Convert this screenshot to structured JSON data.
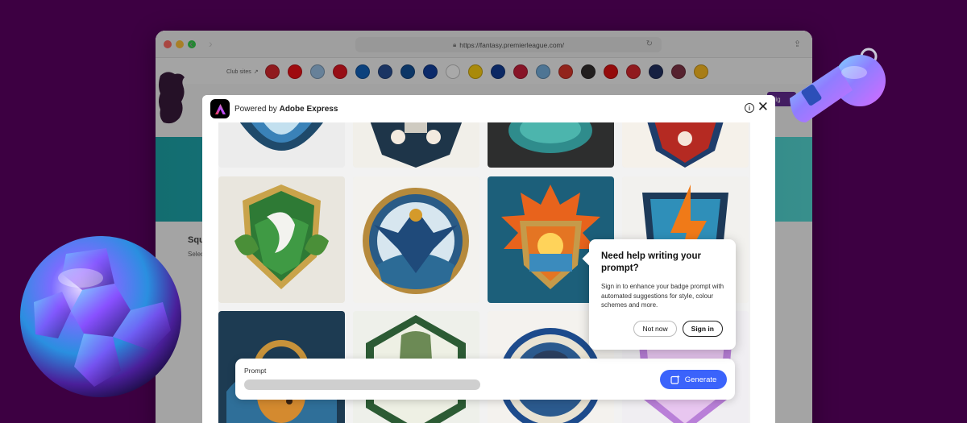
{
  "browser": {
    "url": "https://fantasy.premierleague.com/",
    "club_sites_label": "Club sites",
    "club_colors": [
      "#d71920",
      "#ef0107",
      "#95bfe5",
      "#e30613",
      "#0057b8",
      "#1b458f",
      "#034694",
      "#003399",
      "#ffffff",
      "#ffcd00",
      "#003090",
      "#c8102e",
      "#6cabdd",
      "#da291c",
      "#241f20",
      "#dd0000",
      "#d71920",
      "#132257",
      "#7a263a",
      "#fdb913"
    ]
  },
  "site": {
    "squad_title": "Squ",
    "squad_sub": "Selec",
    "sign_label": "Sig"
  },
  "modal": {
    "powered_by_prefix": "Powered by ",
    "powered_by_brand": "Adobe Express",
    "close_icon": "close-icon",
    "info_icon": "info-icon"
  },
  "prompt": {
    "label": "Prompt",
    "generate_label": "Generate"
  },
  "help_popover": {
    "title": "Need help writing your prompt?",
    "body": "Sign in to enhance your badge prompt with automated suggestions for style, colour schemes and more.",
    "not_now_label": "Not now",
    "sign_in_label": "Sign in"
  },
  "colors": {
    "background": "#3d0042",
    "generate_button": "#3b63fb",
    "adobe_logo": "#000000"
  }
}
